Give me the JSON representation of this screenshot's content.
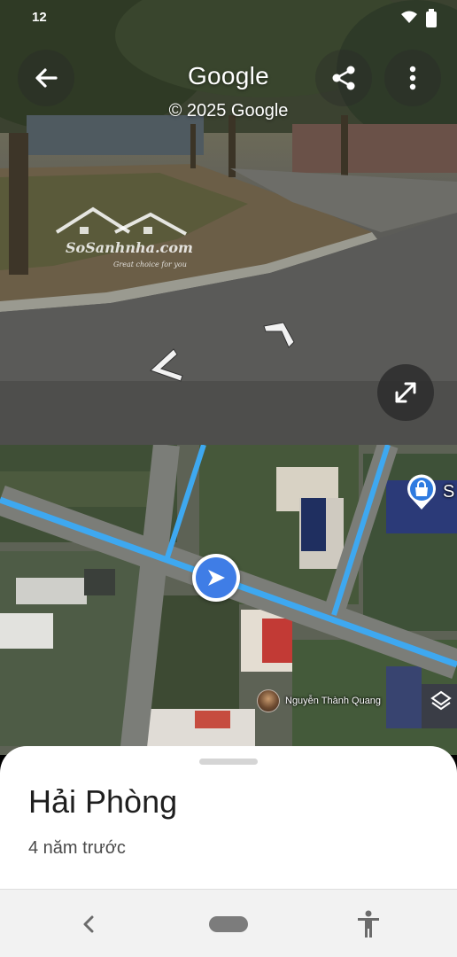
{
  "status_bar": {
    "time": "12",
    "icons": [
      "wifi-icon",
      "battery-icon"
    ]
  },
  "street_view": {
    "title": "Google",
    "copyright": "© 2025 Google",
    "watermark": {
      "brand": "SoSanhnha.com",
      "tagline": "Great choice for you"
    },
    "buttons": {
      "back": "back-arrow-icon",
      "share": "share-icon",
      "more": "more-vert-icon",
      "expand": "expand-icon"
    }
  },
  "map": {
    "poi_label": "S",
    "contributor": "Nguyễn Thành Quang",
    "colors": {
      "route": "#3ea8f0",
      "marker": "#3f7de6"
    }
  },
  "sheet": {
    "title": "Hải Phòng",
    "subtitle": "4 năm trước"
  },
  "nav_bar": {
    "icons": [
      "back-chevron-icon",
      "home-pill-icon",
      "accessibility-icon"
    ]
  }
}
